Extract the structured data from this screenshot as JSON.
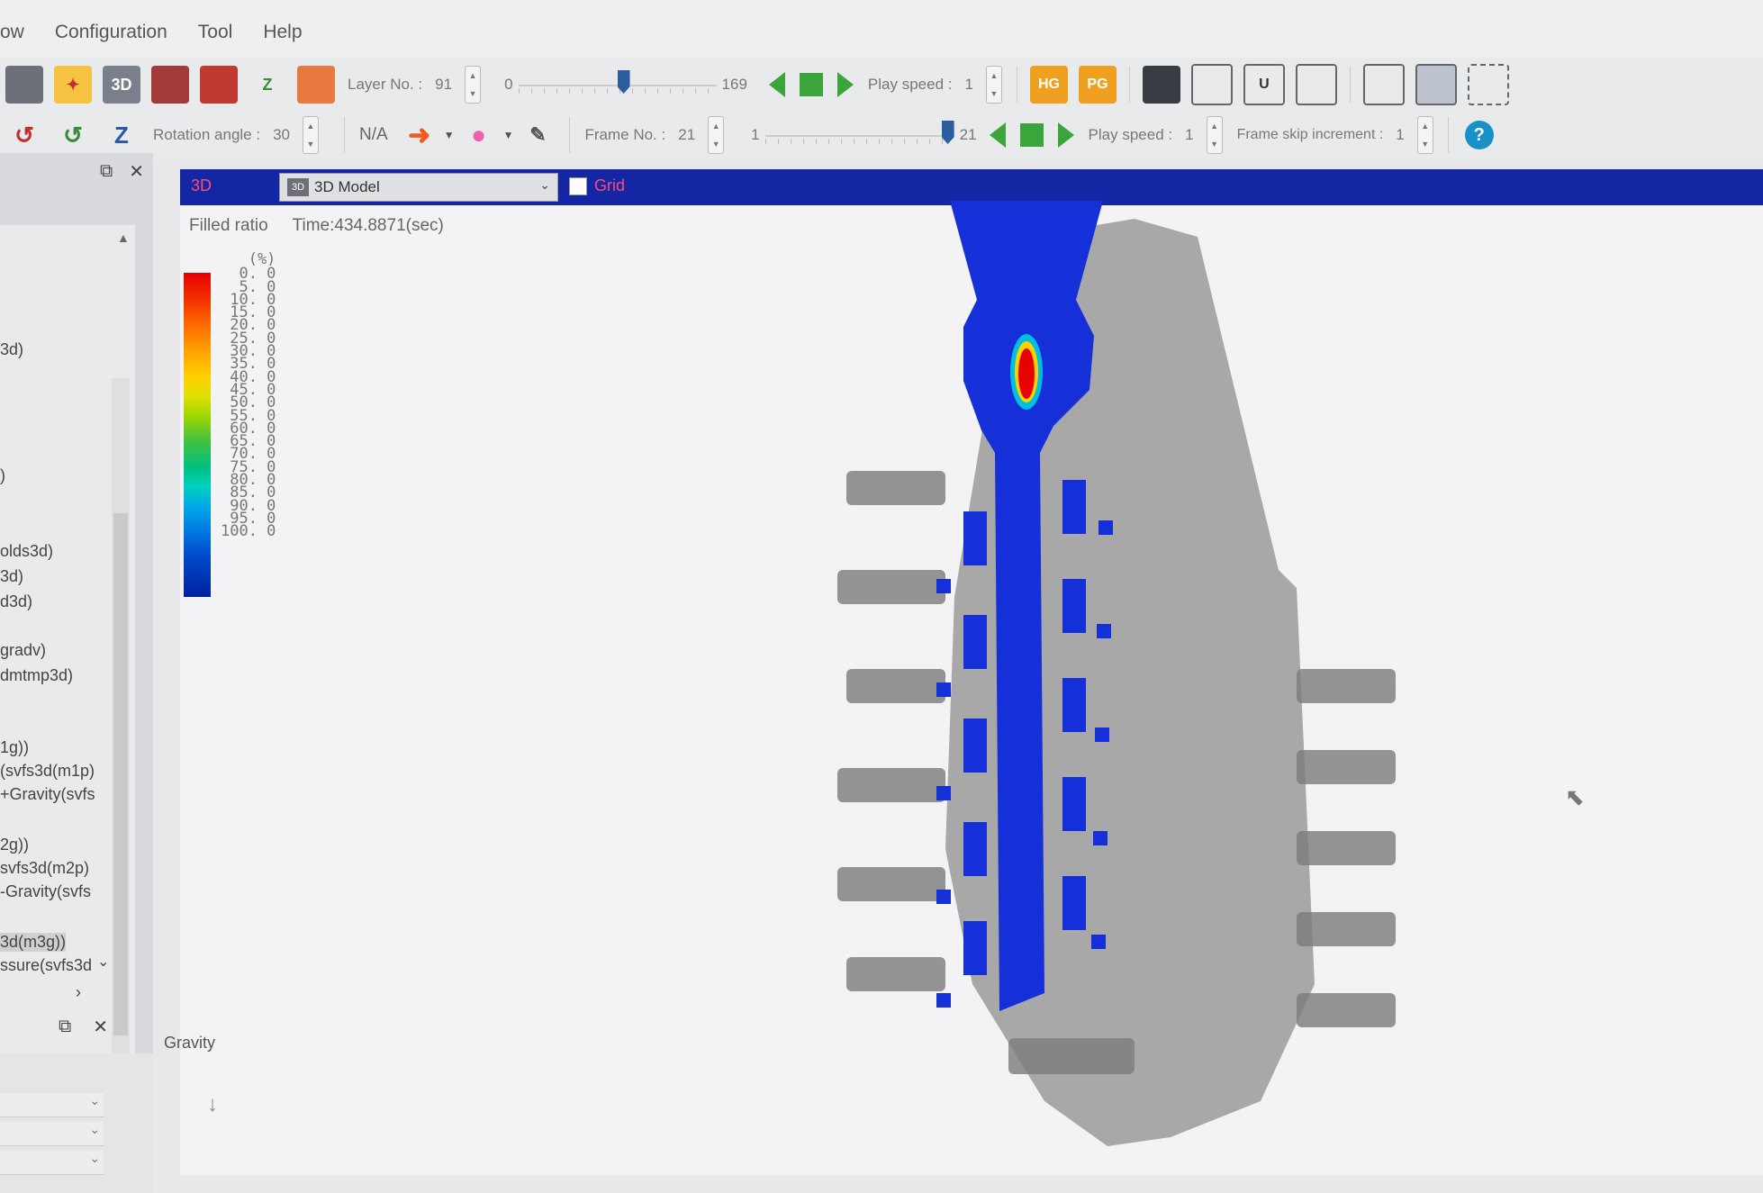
{
  "menu": [
    "ow",
    "Configuration",
    "Tool",
    "Help"
  ],
  "toolbar1": {
    "layer_label": "Layer No. :",
    "layer_value": "91",
    "slider_min": "0",
    "slider_max": "169",
    "play_speed_label": "Play speed :",
    "play_speed_value": "1",
    "hg_label": "HG",
    "pg_label": "PG",
    "three_d_label": "3D",
    "u_label": "U",
    "z_label": "Z"
  },
  "toolbar2": {
    "rotation_label": "Rotation angle :",
    "rotation_value": "30",
    "na_label": "N/A",
    "frame_label": "Frame No. :",
    "frame_value": "21",
    "frame_min": "1",
    "frame_max": "21",
    "play_speed_label": "Play speed :",
    "play_speed_value": "1",
    "skip_label": "Frame skip increment :",
    "skip_value": "1",
    "help_label": "?"
  },
  "left_panel": {
    "items": [
      "3d)",
      ")",
      "olds3d)",
      "3d)",
      "d3d)",
      "gradv)",
      "dmtmp3d)",
      "1g))",
      "(svfs3d(m1p)",
      "+Gravity(svfs",
      "2g))",
      "svfs3d(m2p)",
      "-Gravity(svfs",
      "3d(m3g))",
      "ssure(svfs3d"
    ]
  },
  "viewport": {
    "tab": "3D",
    "view_select": "3D Model",
    "view_icon": "3D",
    "grid_label": "Grid",
    "info_title": "Filled ratio",
    "time_text": "Time:434.8871(sec)",
    "unit": "(%)",
    "scale": [
      "0. 0",
      "5. 0",
      "10. 0",
      "15. 0",
      "20. 0",
      "25. 0",
      "30. 0",
      "35. 0",
      "40. 0",
      "45. 0",
      "50. 0",
      "55. 0",
      "60. 0",
      "65. 0",
      "70. 0",
      "75. 0",
      "80. 0",
      "85. 0",
      "90. 0",
      "95. 0",
      "100. 0"
    ],
    "gravity_label": "Gravity"
  },
  "colors": {
    "viewport_header": "#1326a3",
    "fill_blue": "#1530d8",
    "hot_red": "#e60000",
    "mold_gray": "#8c8c8c"
  }
}
